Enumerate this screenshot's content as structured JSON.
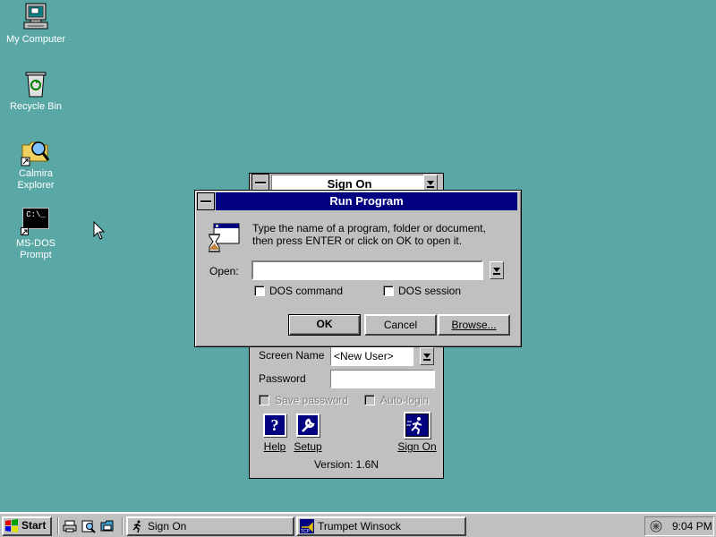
{
  "desktop": {
    "icons": [
      {
        "label": "My Computer",
        "icon": "computer-icon"
      },
      {
        "label": "Recycle Bin",
        "icon": "recycle-bin-icon"
      },
      {
        "label": "Calmira Explorer",
        "label_lines": [
          "Calmira",
          "Explorer"
        ],
        "icon": "explorer-icon"
      },
      {
        "label": "MS-DOS Prompt",
        "label_lines": [
          "MS-DOS",
          "Prompt"
        ],
        "icon": "dos-prompt-icon",
        "icon_text": "C:\\_"
      }
    ],
    "background_color": "#5aa8a6"
  },
  "signon_window": {
    "title": "Sign On",
    "screen_name_label": "Screen Name",
    "screen_name_value": "<New User>",
    "password_label": "Password",
    "password_value": "",
    "save_password_label": "Save password",
    "auto_login_label": "Auto-login",
    "help_label": "Help",
    "setup_label": "Setup",
    "signon_label": "Sign On",
    "version": "Version: 1.6N"
  },
  "run_dialog": {
    "title": "Run Program",
    "instructions_line1": "Type the name of a program, folder or document,",
    "instructions_line2": "then press ENTER or click on OK to open it.",
    "open_label": "Open:",
    "open_value": "",
    "dos_command_label": "DOS command",
    "dos_session_label": "DOS session",
    "ok_label": "OK",
    "cancel_label": "Cancel",
    "browse_label": "Browse...",
    "title_color": "#000080"
  },
  "taskbar": {
    "start_label": "Start",
    "tasks": [
      {
        "label": "Sign On",
        "icon": "running-man-icon"
      },
      {
        "label": "Trumpet Winsock",
        "icon": "trumpet-winsock-icon"
      }
    ],
    "clock": "9:04 PM"
  }
}
